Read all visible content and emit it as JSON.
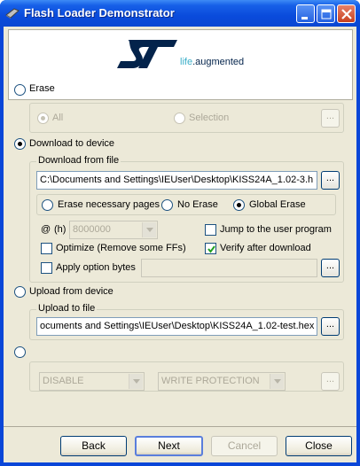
{
  "window": {
    "title": "Flash Loader Demonstrator"
  },
  "logo": {
    "tagline_prefix": "life",
    "tagline_suffix": ".augmented"
  },
  "erase": {
    "label": "Erase",
    "all_label": "All",
    "selection_label": "Selection",
    "ellipsis": "..."
  },
  "download": {
    "label": "Download to device",
    "group_label": "Download from file",
    "file_path": "C:\\Documents and Settings\\IEUser\\Desktop\\KISS24A_1.02-3.h",
    "ellipsis": "...",
    "erase_options": [
      "Erase necessary pages",
      "No Erase",
      "Global Erase"
    ],
    "selected_erase_option": "Global Erase",
    "address_prefix": "@",
    "address_unit": "(h)",
    "address_value": "8000000",
    "optimize_label": "Optimize (Remove some FFs)",
    "jump_label": "Jump to the user program",
    "verify_label": "Verify after download",
    "option_bytes_label": "Apply option bytes",
    "optimize_checked": false,
    "jump_checked": false,
    "verify_checked": true,
    "option_bytes_checked": false
  },
  "upload": {
    "label": "Upload from device",
    "group_label": "Upload to file",
    "file_path": "ocuments and Settings\\IEUser\\Desktop\\KISS24A_1.02-test.hex",
    "ellipsis": "..."
  },
  "protection": {
    "state_value": "DISABLE",
    "protection_value": "WRITE PROTECTION",
    "ellipsis": "..."
  },
  "buttons": {
    "back": "Back",
    "next": "Next",
    "cancel": "Cancel",
    "close": "Close"
  },
  "colors": {
    "titlebar": "#0a4bdc",
    "dialog": "#ece9d8",
    "st_logo": "#03234b",
    "tagline": "#3aaec8"
  }
}
